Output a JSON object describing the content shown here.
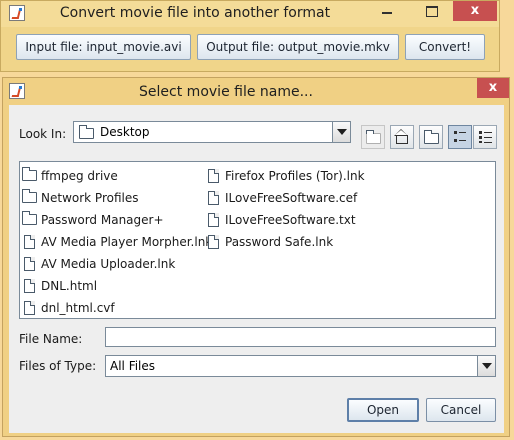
{
  "main_window": {
    "title": "Convert movie file into another format",
    "close_label": "x",
    "buttons": {
      "input": "Input file: input_movie.avi",
      "output": "Output file: output_movie.mkv",
      "convert": "Convert!"
    }
  },
  "dialog": {
    "title": "Select movie file name...",
    "close_label": "x",
    "look_in": {
      "label": "Look In:",
      "value": "Desktop"
    },
    "toolbar": [
      "up-one-level-icon",
      "home-icon",
      "new-folder-icon",
      "list-view-icon",
      "details-view-icon"
    ],
    "active_view": "list",
    "files_col1": [
      {
        "name": "ffmpeg drive",
        "type": "folder"
      },
      {
        "name": "Network Profiles",
        "type": "folder"
      },
      {
        "name": "Password Manager+",
        "type": "folder"
      },
      {
        "name": "AV Media Player Morpher.lnk",
        "type": "file"
      },
      {
        "name": "AV Media Uploader.lnk",
        "type": "file"
      },
      {
        "name": "DNL.html",
        "type": "file"
      },
      {
        "name": "dnl_html.cvf",
        "type": "file"
      }
    ],
    "files_col2": [
      {
        "name": "Firefox Profiles (Tor).lnk",
        "type": "file"
      },
      {
        "name": "ILoveFreeSoftware.cef",
        "type": "file"
      },
      {
        "name": "ILoveFreeSoftware.txt",
        "type": "file"
      },
      {
        "name": "Password Safe.lnk",
        "type": "file"
      }
    ],
    "file_name": {
      "label": "File Name:",
      "value": ""
    },
    "files_of_type": {
      "label": "Files of Type:",
      "value": "All Files"
    },
    "buttons": {
      "open": "Open",
      "cancel": "Cancel"
    }
  },
  "colors": {
    "desktop_background": "#f7d89a",
    "title_close": "#c75050",
    "dialog_body": "#eeeeee"
  }
}
